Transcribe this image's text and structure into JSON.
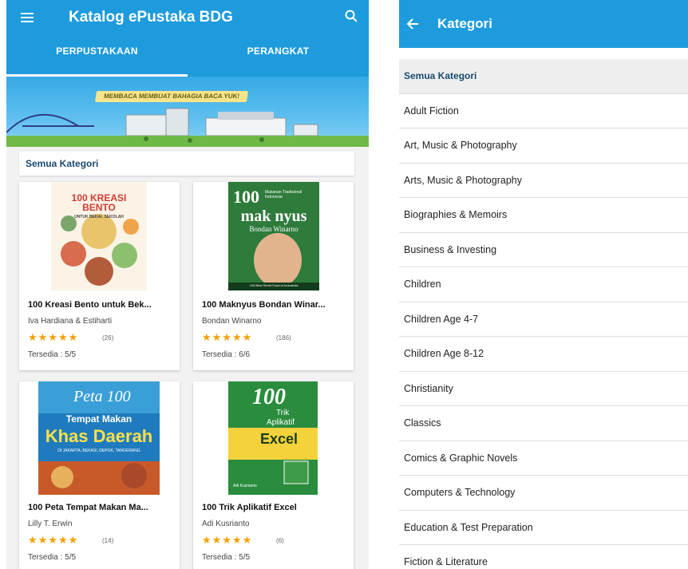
{
  "left": {
    "appbar": {
      "title": "Katalog ePustaka BDG"
    },
    "tabs": [
      {
        "label": "PERPUSTAKAAN"
      },
      {
        "label": "PERANGKAT"
      }
    ],
    "banner": {
      "slogan": "MEMBACA MEMBUAT BAHAGIA BACA YUK!"
    },
    "category": "Semua Kategori",
    "books": [
      {
        "title": "100 Kreasi Bento untuk Bek...",
        "author": "Iva Hardiana & Estiharti",
        "stars": "★★★★★",
        "count": "(26)",
        "availability": "Tersedia : 5/5",
        "cover": {
          "l1": "100 KREASI",
          "l2": "BENTO",
          "l3": "UNTUK BEKAL SEKOLAH"
        }
      },
      {
        "title": "100 Maknyus Bondan Winar...",
        "author": "Bondan Winarno",
        "stars": "★★★★★",
        "count": "(186)",
        "availability": "Tersedia : 6/6",
        "cover": {
          "l1": "100",
          "l2": "mak nyus",
          "l3": "Bondan Winarno",
          "l4": "100 Best Street Food of Indonesia",
          "side": "Makanan Tradisional Indonesia"
        }
      },
      {
        "title": "100 Peta Tempat Makan Ma...",
        "author": "Lilly T. Erwin",
        "stars": "★★★★★",
        "count": "(14)",
        "availability": "Tersedia : 5/5",
        "cover": {
          "l1": "Peta 100",
          "l2": "Tempat Makan",
          "l3": "Khas Daerah",
          "l4": "DI JAKARTA, BEKASI, DEPOK, TANGERANG"
        }
      },
      {
        "title": "100 Trik Aplikatif Excel",
        "author": "Adi Kusrianto",
        "stars": "★★★★★",
        "count": "(6)",
        "availability": "Tersedia : 5/5",
        "cover": {
          "l1": "100",
          "l2": "Trik",
          "l3": "Aplikatif",
          "l4": "Excel",
          "l5": "Adi Kusrianto"
        }
      }
    ]
  },
  "right": {
    "appbar": {
      "title": "Kategori"
    },
    "categories": [
      "Semua Kategori",
      "Adult Fiction",
      "Art, Music & Photography",
      "Arts, Music & Photography",
      "Biographies & Memoirs",
      "Business & Investing",
      "Children",
      "Children Age 4-7",
      "Children Age 8-12",
      "Christianity",
      "Classics",
      "Comics & Graphic Novels",
      "Computers & Technology",
      "Education & Test Preparation",
      "Fiction & Literature"
    ]
  },
  "colors": {
    "primary": "#1d9bdc",
    "star": "#f2a000",
    "category_text": "#1a4b6e"
  },
  "icons": [
    "menu-icon",
    "search-icon",
    "back-arrow-icon",
    "star-icon"
  ]
}
